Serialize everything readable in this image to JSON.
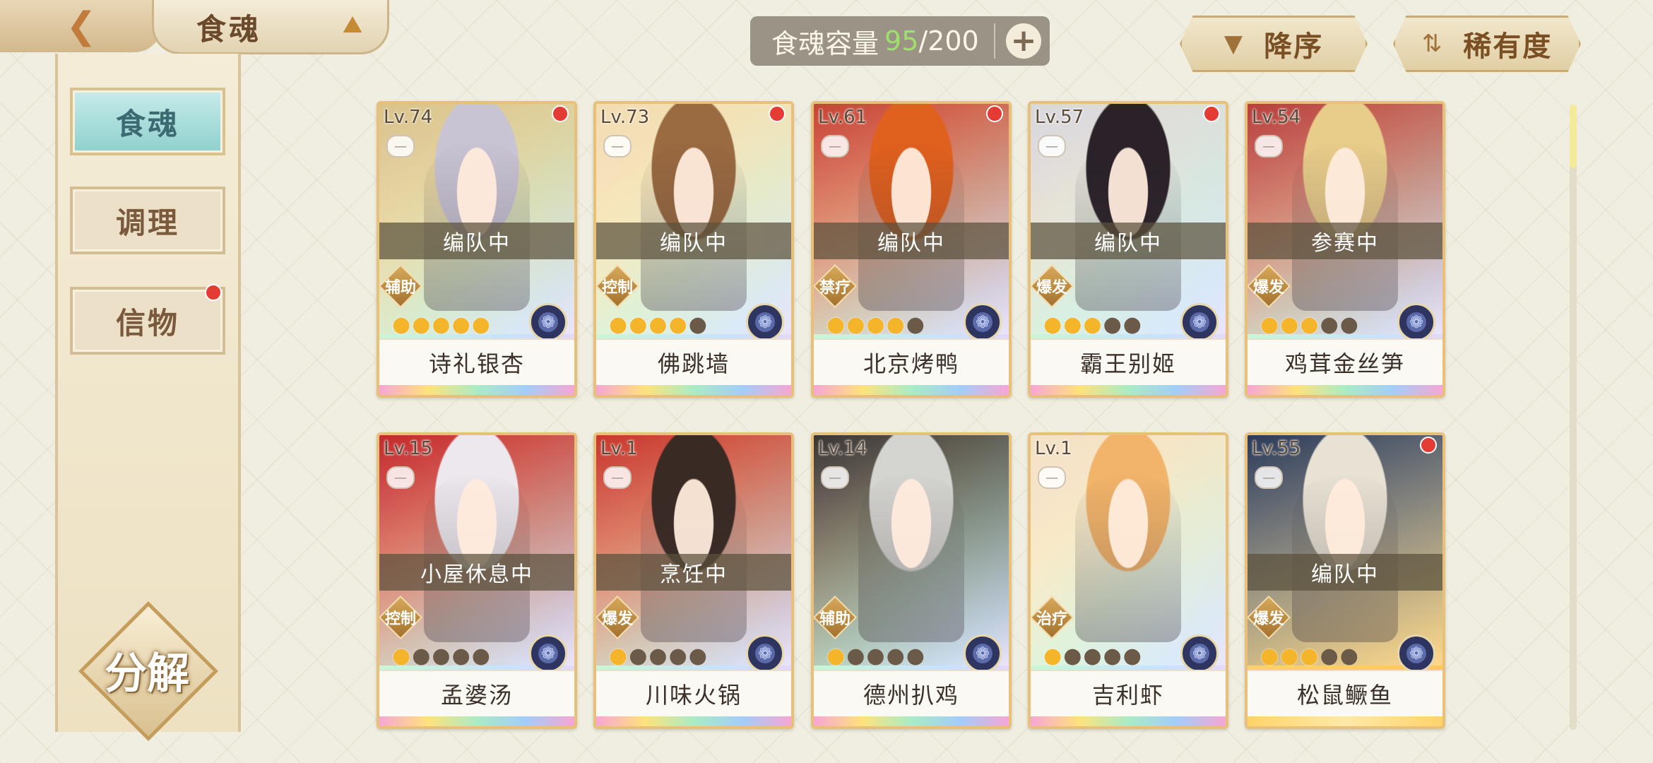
{
  "header": {
    "back_icon": "back-arrow-icon",
    "title": "食魂",
    "title_icon": "pavilion-icon",
    "capacity_label": "食魂容量",
    "capacity_current": "95",
    "capacity_max": "/200",
    "add_icon": "+"
  },
  "sort": {
    "order_label": "降序",
    "order_icon": "▼",
    "field_label": "稀有度",
    "field_icon": "⇅"
  },
  "sidebar": {
    "tabs": [
      {
        "label": "食魂",
        "active": true
      },
      {
        "label": "调理",
        "active": false
      },
      {
        "label": "信物",
        "active": false,
        "badge": true
      }
    ],
    "decompose_label": "分解"
  },
  "cards": [
    {
      "level": "Lv.74",
      "status": "编队中",
      "role": "辅助",
      "stars": 5,
      "max_stars": 5,
      "name": "诗礼银杏",
      "red_dot": true,
      "frame": "rainbow",
      "hair": "#c9c4d4",
      "bg": "#d9c48a"
    },
    {
      "level": "Lv.73",
      "status": "编队中",
      "role": "控制",
      "stars": 4,
      "max_stars": 5,
      "name": "佛跳墙",
      "red_dot": true,
      "frame": "rainbow",
      "hair": "#9a6a40",
      "bg": "#f2ddb0"
    },
    {
      "level": "Lv.61",
      "status": "编队中",
      "role": "禁疗",
      "stars": 4,
      "max_stars": 5,
      "name": "北京烤鸭",
      "red_dot": true,
      "frame": "rainbow",
      "hair": "#e0601e",
      "bg": "#c84432"
    },
    {
      "level": "Lv.57",
      "status": "编队中",
      "role": "爆发",
      "stars": 3,
      "max_stars": 5,
      "name": "霸王别姬",
      "red_dot": true,
      "frame": "rainbow",
      "hair": "#2a2228",
      "bg": "#d8d8dc"
    },
    {
      "level": "Lv.54",
      "status": "参赛中",
      "role": "爆发",
      "stars": 3,
      "max_stars": 5,
      "name": "鸡茸金丝笋",
      "red_dot": false,
      "frame": "rainbow",
      "hair": "#e8cc8a",
      "bg": "#b8403a"
    },
    {
      "level": "Lv.15",
      "status": "小屋休息中",
      "role": "控制",
      "stars": 1,
      "max_stars": 5,
      "name": "孟婆汤",
      "red_dot": false,
      "frame": "rainbow",
      "hair": "#ece8ee",
      "bg": "#c42a2a"
    },
    {
      "level": "Lv.1",
      "status": "烹饪中",
      "role": "爆发",
      "stars": 1,
      "max_stars": 5,
      "name": "川味火锅",
      "red_dot": false,
      "frame": "rainbow",
      "hair": "#3a2a24",
      "bg": "#c8382a"
    },
    {
      "level": "Lv.14",
      "status": "",
      "role": "辅助",
      "stars": 1,
      "max_stars": 5,
      "name": "德州扒鸡",
      "red_dot": false,
      "frame": "rainbow",
      "hair": "#d4d4d0",
      "bg": "#3a3632"
    },
    {
      "level": "Lv.1",
      "status": "",
      "role": "治疗",
      "stars": 1,
      "max_stars": 5,
      "name": "吉利虾",
      "red_dot": false,
      "frame": "rainbow",
      "hair": "#f2b46a",
      "bg": "#f4e2c4"
    },
    {
      "level": "Lv.55",
      "status": "编队中",
      "role": "爆发",
      "stars": 3,
      "max_stars": 5,
      "name": "松鼠鳜鱼",
      "red_dot": true,
      "frame": "gold",
      "hair": "#e8e2d4",
      "bg": "#2c3a58"
    }
  ]
}
